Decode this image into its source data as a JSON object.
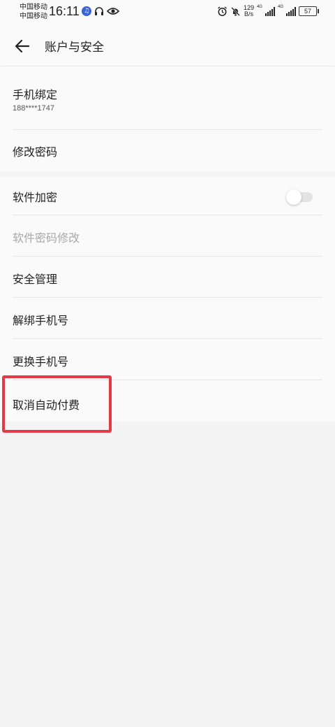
{
  "status_bar": {
    "carrier_1": "中国移动",
    "carrier_2": "中国移动",
    "time": "16:11",
    "net_speed_value": "129",
    "net_speed_unit": "B/s",
    "signal_1_label": "4G",
    "signal_2_label": "4G",
    "battery_level": "57"
  },
  "header": {
    "title": "账户与安全"
  },
  "section_1": {
    "phone_binding": {
      "label": "手机绑定",
      "value": "188****1747"
    },
    "change_password": {
      "label": "修改密码"
    }
  },
  "section_2": {
    "software_encryption": {
      "label": "软件加密",
      "enabled": false
    },
    "software_password_change": {
      "label": "软件密码修改"
    },
    "security_management": {
      "label": "安全管理"
    },
    "unbind_phone": {
      "label": "解绑手机号"
    },
    "change_phone": {
      "label": "更换手机号"
    },
    "cancel_auto_pay": {
      "label": "取消自动付费"
    }
  },
  "colors": {
    "highlight": "#e63946",
    "background": "#f4f4f4",
    "surface": "#fafafa"
  }
}
